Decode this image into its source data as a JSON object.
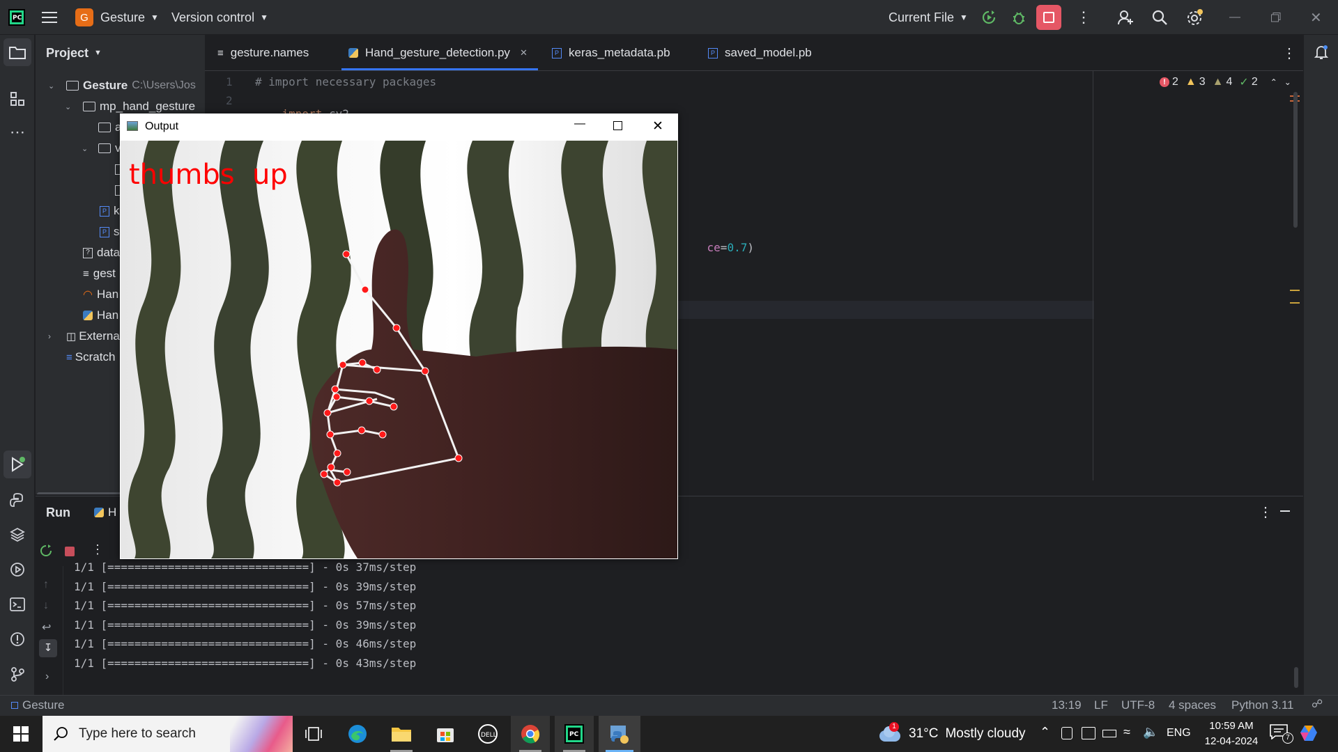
{
  "titlebar": {
    "project_badge": "G",
    "project_name": "Gesture",
    "version_control": "Version control",
    "run_config": "Current File"
  },
  "project_panel": {
    "title": "Project",
    "tree": [
      {
        "name": "Gesture",
        "path": "C:\\Users\\Jos"
      },
      {
        "name": "mp_hand_gesture"
      },
      {
        "name": "a"
      },
      {
        "name": "v"
      },
      {
        "name": ""
      },
      {
        "name": ""
      },
      {
        "name": "k"
      },
      {
        "name": "s"
      },
      {
        "name": "data"
      },
      {
        "name": "gest"
      },
      {
        "name": "Han"
      },
      {
        "name": "Han"
      },
      {
        "name": "Externa"
      },
      {
        "name": "Scratch"
      }
    ]
  },
  "tabs": [
    {
      "label": "gesture.names"
    },
    {
      "label": "Hand_gesture_detection.py",
      "active": true
    },
    {
      "label": "keras_metadata.pb"
    },
    {
      "label": "saved_model.pb"
    }
  ],
  "inspections": {
    "errors": "2",
    "warnings": "3",
    "weak_warnings": "4",
    "typos": "2"
  },
  "editor": {
    "lines": [
      {
        "num": "1",
        "text": "# import necessary packages",
        "kind": "comment"
      },
      {
        "num": "2",
        "kw": "import",
        "rest": " cv2",
        "kind": "code"
      }
    ],
    "partial_fragment": {
      "before": "ce",
      "op": "=",
      "num": "0.7",
      "after": ")"
    }
  },
  "run_panel": {
    "title": "Run",
    "tab_label": "H",
    "log": [
      "1/1 [==============================] - 0s 37ms/step",
      "1/1 [==============================] - 0s 39ms/step",
      "1/1 [==============================] - 0s 57ms/step",
      "1/1 [==============================] - 0s 39ms/step",
      "1/1 [==============================] - 0s 46ms/step",
      "1/1 [==============================] - 0s 43ms/step"
    ]
  },
  "output_window": {
    "title": "Output",
    "gesture_label": "thumbs  up",
    "label_color": "#ff0000"
  },
  "statusbar": {
    "project": "Gesture",
    "position": "13:19",
    "line_sep": "LF",
    "encoding": "UTF-8",
    "indent": "4 spaces",
    "interpreter": "Python 3.11"
  },
  "taskbar": {
    "search_placeholder": "Type here to search",
    "weather_temp": "31°C",
    "weather_desc": "Mostly cloudy",
    "weather_badge": "1",
    "language": "ENG",
    "time": "10:59 AM",
    "date": "12-04-2024",
    "notif_count": "7"
  },
  "colors": {
    "ide_bg": "#1e1f22",
    "panel_bg": "#2b2d30",
    "stop_red": "#e55765",
    "run_green": "#5fb865",
    "keyword": "#cf8e6d",
    "comment": "#7a7e85",
    "number": "#2aacb8"
  }
}
